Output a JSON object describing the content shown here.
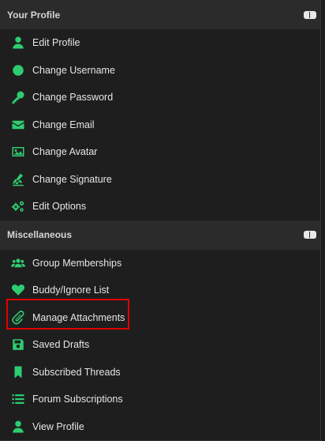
{
  "sections": [
    {
      "title": "Your Profile",
      "items": [
        {
          "label": "Edit Profile",
          "icon": "user-icon"
        },
        {
          "label": "Change Username",
          "icon": "circle-icon"
        },
        {
          "label": "Change Password",
          "icon": "key-icon"
        },
        {
          "label": "Change Email",
          "icon": "envelope-icon"
        },
        {
          "label": "Change Avatar",
          "icon": "image-icon"
        },
        {
          "label": "Change Signature",
          "icon": "signature-icon"
        },
        {
          "label": "Edit Options",
          "icon": "cogs-icon"
        }
      ]
    },
    {
      "title": "Miscellaneous",
      "items": [
        {
          "label": "Group Memberships",
          "icon": "users-icon"
        },
        {
          "label": "Buddy/Ignore List",
          "icon": "heart-icon"
        },
        {
          "label": "Manage Attachments",
          "icon": "paperclip-icon"
        },
        {
          "label": "Saved Drafts",
          "icon": "save-icon"
        },
        {
          "label": "Subscribed Threads",
          "icon": "bookmark-icon"
        },
        {
          "label": "Forum Subscriptions",
          "icon": "list-icon"
        },
        {
          "label": "View Profile",
          "icon": "user-icon"
        }
      ]
    }
  ],
  "colors": {
    "accent": "#2ecc71",
    "highlight": "#e00000",
    "background": "#1e1e1e",
    "header": "#2b2b2b"
  }
}
